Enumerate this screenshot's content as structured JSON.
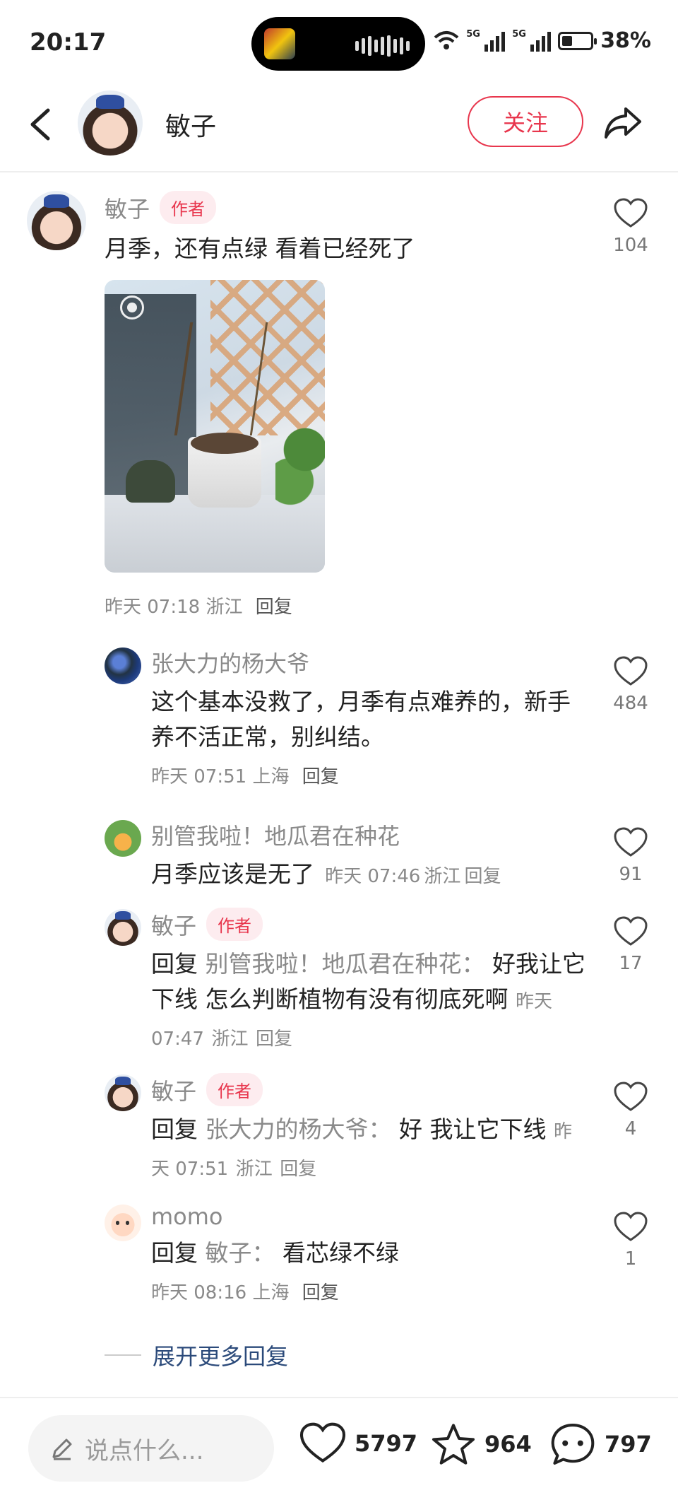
{
  "status_bar": {
    "time": "20:17",
    "network_1": "5G",
    "network_2": "5G",
    "battery": "38%"
  },
  "header": {
    "username": "敏子",
    "follow_label": "关注"
  },
  "main_comment": {
    "author": "敏子",
    "author_tag": "作者",
    "text": "月季，还有点绿 看着已经死了",
    "time": "昨天 07:18",
    "location": "浙江",
    "reply_label": "回复",
    "likes": "104"
  },
  "replies": [
    {
      "author": "张大力的杨大爷",
      "text": "这个基本没救了，月季有点难养的，新手养不活正常，别纠结。",
      "time": "昨天 07:51",
      "location": "上海",
      "reply_label": "回复",
      "likes": "484"
    },
    {
      "author": "别管我啦！地瓜君在种花",
      "text": "月季应该是无了",
      "time": "昨天 07:46",
      "location": "浙江",
      "reply_label": "回复",
      "likes": "91"
    },
    {
      "author": "敏子",
      "author_tag": "作者",
      "reply_prefix": "回复",
      "reply_to": "别管我啦！地瓜君在种花：",
      "text": "好我让它下线 怎么判断植物有没有彻底死啊",
      "time": "昨天 07:47",
      "location": "浙江",
      "reply_label": "回复",
      "likes": "17"
    },
    {
      "author": "敏子",
      "author_tag": "作者",
      "reply_prefix": "回复",
      "reply_to": "张大力的杨大爷：",
      "text": "好 我让它下线",
      "time": "昨天 07:51",
      "location": "浙江",
      "reply_label": "回复",
      "likes": "4"
    },
    {
      "author": "momo",
      "reply_prefix": "回复",
      "reply_to": "敏子：",
      "text": "看芯绿不绿",
      "time": "昨天 08:16",
      "location": "上海",
      "reply_label": "回复",
      "likes": "1"
    }
  ],
  "expand_more_label": "展开更多回复",
  "bottom_bar": {
    "input_placeholder": "说点什么...",
    "likes": "5797",
    "favorites": "964",
    "comments": "797"
  },
  "colors": {
    "accent": "#e8364d",
    "link": "#2b4a7a",
    "muted": "#8a8a8a"
  }
}
